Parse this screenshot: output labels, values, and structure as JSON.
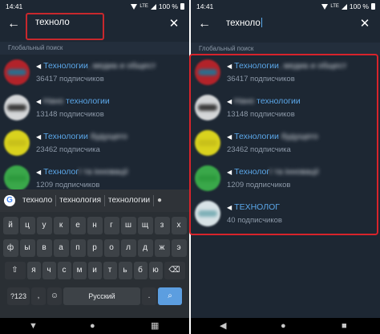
{
  "status": {
    "time": "14:41",
    "network": "LTE",
    "battery": "100 %"
  },
  "search": {
    "query": "техноло"
  },
  "section_label": "Глобальный поиск",
  "results": [
    {
      "prefix": "",
      "hl": "Технологии",
      "blur": ", медиа и общест",
      "rest": "",
      "subscribers": "36417 подписчиков",
      "avatar": "#b2232a",
      "band": "#2d6d8c"
    },
    {
      "prefix": "Нано ",
      "hl": "технологии",
      "blur": "",
      "rest": "",
      "subscribers": "13148 подписчиков",
      "avatar": "#d4d6d8",
      "band": "#3a3a3a"
    },
    {
      "prefix": "",
      "hl": "Технологии",
      "blur": " будущего",
      "rest": "",
      "subscribers": "23462 подписчика",
      "avatar": "#d9d21e",
      "band": "#c8c01a"
    },
    {
      "prefix": "",
      "hl": "Технолог",
      "blur": "ї та інновації",
      "rest": "",
      "subscribers": "1209 подписчиков",
      "avatar": "#3aa84a",
      "band": "#2e9a3e"
    },
    {
      "prefix": "",
      "hl": "ТЕХНОЛОГ",
      "blur": "",
      "rest": "",
      "subscribers": "40 подписчиков",
      "avatar": "#d7e2e6",
      "band": "#7fb0b7"
    }
  ],
  "keyboard": {
    "suggestions": [
      "техноло",
      "технология",
      "технологии"
    ],
    "row1": [
      "й",
      "ц",
      "у",
      "к",
      "е",
      "н",
      "г",
      "ш",
      "щ",
      "з",
      "х"
    ],
    "row2": [
      "ф",
      "ы",
      "в",
      "а",
      "п",
      "р",
      "о",
      "л",
      "д",
      "ж",
      "э"
    ],
    "row3": [
      "я",
      "ч",
      "с",
      "м",
      "и",
      "т",
      "ь",
      "б",
      "ю"
    ],
    "symbols_label": "?123",
    "comma": ",",
    "space_label": "Русский",
    "period": "."
  }
}
